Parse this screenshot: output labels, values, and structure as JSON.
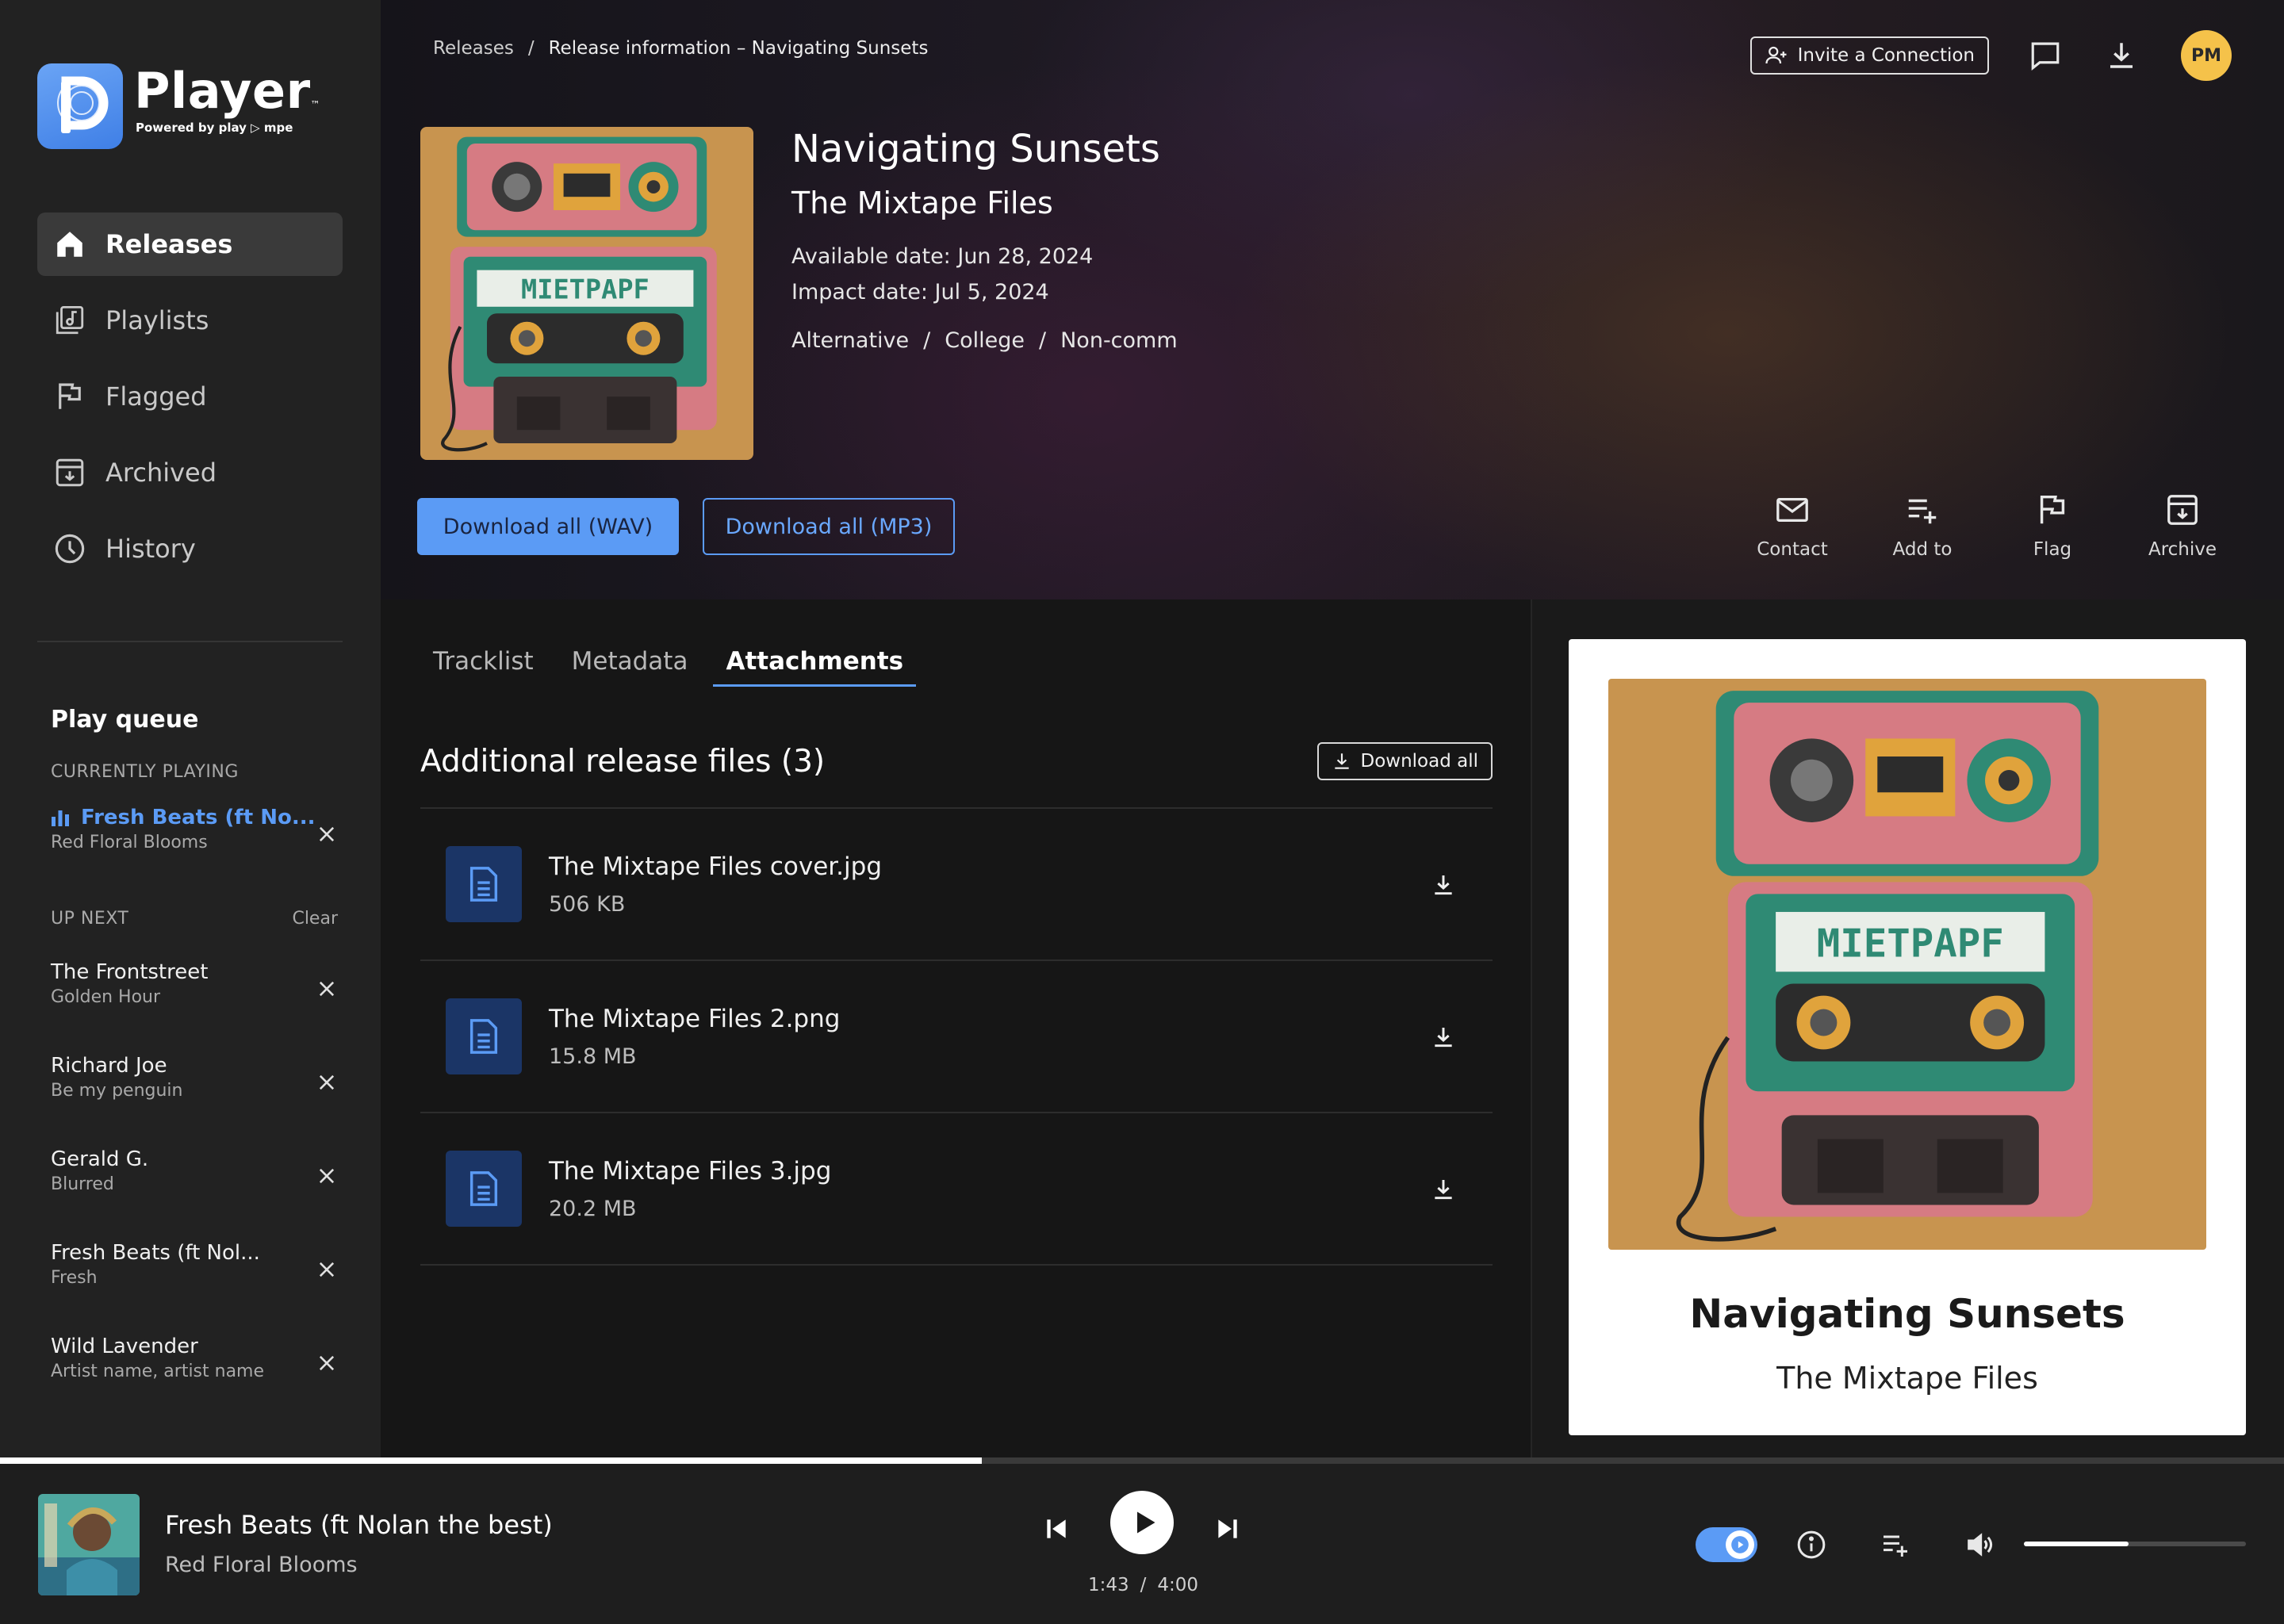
{
  "app": {
    "name": "Player",
    "tm": "™",
    "tagline": "Powered by play ▷ mpe"
  },
  "nav": [
    {
      "label": "Releases",
      "icon": "home-icon",
      "active": true
    },
    {
      "label": "Playlists",
      "icon": "playlist-icon",
      "active": false
    },
    {
      "label": "Flagged",
      "icon": "flag-icon",
      "active": false
    },
    {
      "label": "Archived",
      "icon": "archive-icon",
      "active": false
    },
    {
      "label": "History",
      "icon": "clock-icon",
      "active": false
    }
  ],
  "queue": {
    "title": "Play queue",
    "currently_playing_label": "CURRENTLY PLAYING",
    "current": {
      "title": "Fresh Beats (ft No...",
      "artist": "Red Floral Blooms"
    },
    "up_next_label": "UP NEXT",
    "clear_label": "Clear",
    "items": [
      {
        "title": "The Frontstreet",
        "artist": "Golden Hour"
      },
      {
        "title": "Richard Joe",
        "artist": "Be my penguin"
      },
      {
        "title": "Gerald G.",
        "artist": "Blurred"
      },
      {
        "title": "Fresh Beats (ft Nol...",
        "artist": "Fresh"
      },
      {
        "title": "Wild Lavender",
        "artist": "Artist name, artist name"
      }
    ]
  },
  "breadcrumb": {
    "root": "Releases",
    "separator": "/",
    "current": "Release information – Navigating Sunsets"
  },
  "header": {
    "invite_label": "Invite a Connection",
    "avatar_initials": "PM"
  },
  "release": {
    "title": "Navigating Sunsets",
    "artist": "The Mixtape Files",
    "available_date": "Available date: Jun 28, 2024",
    "impact_date": "Impact date:  Jul 5, 2024",
    "tags": [
      "Alternative",
      "College",
      "Non-comm"
    ],
    "tag_separator": "/",
    "download_wav_label": "Download all (WAV)",
    "download_mp3_label": "Download all (MP3)",
    "actions": [
      {
        "label": "Contact",
        "icon": "mail-icon"
      },
      {
        "label": "Add to",
        "icon": "playlist-add-icon"
      },
      {
        "label": "Flag",
        "icon": "flag-icon"
      },
      {
        "label": "Archive",
        "icon": "archive-icon"
      }
    ],
    "cover_label": "MIETPAPF"
  },
  "tabs": [
    {
      "label": "Tracklist",
      "active": false
    },
    {
      "label": "Metadata",
      "active": false
    },
    {
      "label": "Attachments",
      "active": true
    }
  ],
  "attachments": {
    "title": "Additional release files (3)",
    "download_all_label": "Download all",
    "files": [
      {
        "name": "The Mixtape Files cover.jpg",
        "size": "506 KB"
      },
      {
        "name": "The Mixtape Files 2.png",
        "size": "15.8 MB"
      },
      {
        "name": "The Mixtape Files 3.jpg",
        "size": "20.2 MB"
      }
    ]
  },
  "preview_card": {
    "title": "Navigating Sunsets",
    "artist": "The Mixtape Files"
  },
  "player": {
    "title": "Fresh Beats (ft Nolan the best)",
    "artist": "Red Floral Blooms",
    "elapsed": "1:43",
    "time_separator": "/",
    "duration": "4:00",
    "progress_fraction": 0.43,
    "volume_fraction": 0.47
  },
  "colors": {
    "accent": "#5b9bf5",
    "avatar": "#f5c24a",
    "cover_bg": "#c8944f"
  }
}
